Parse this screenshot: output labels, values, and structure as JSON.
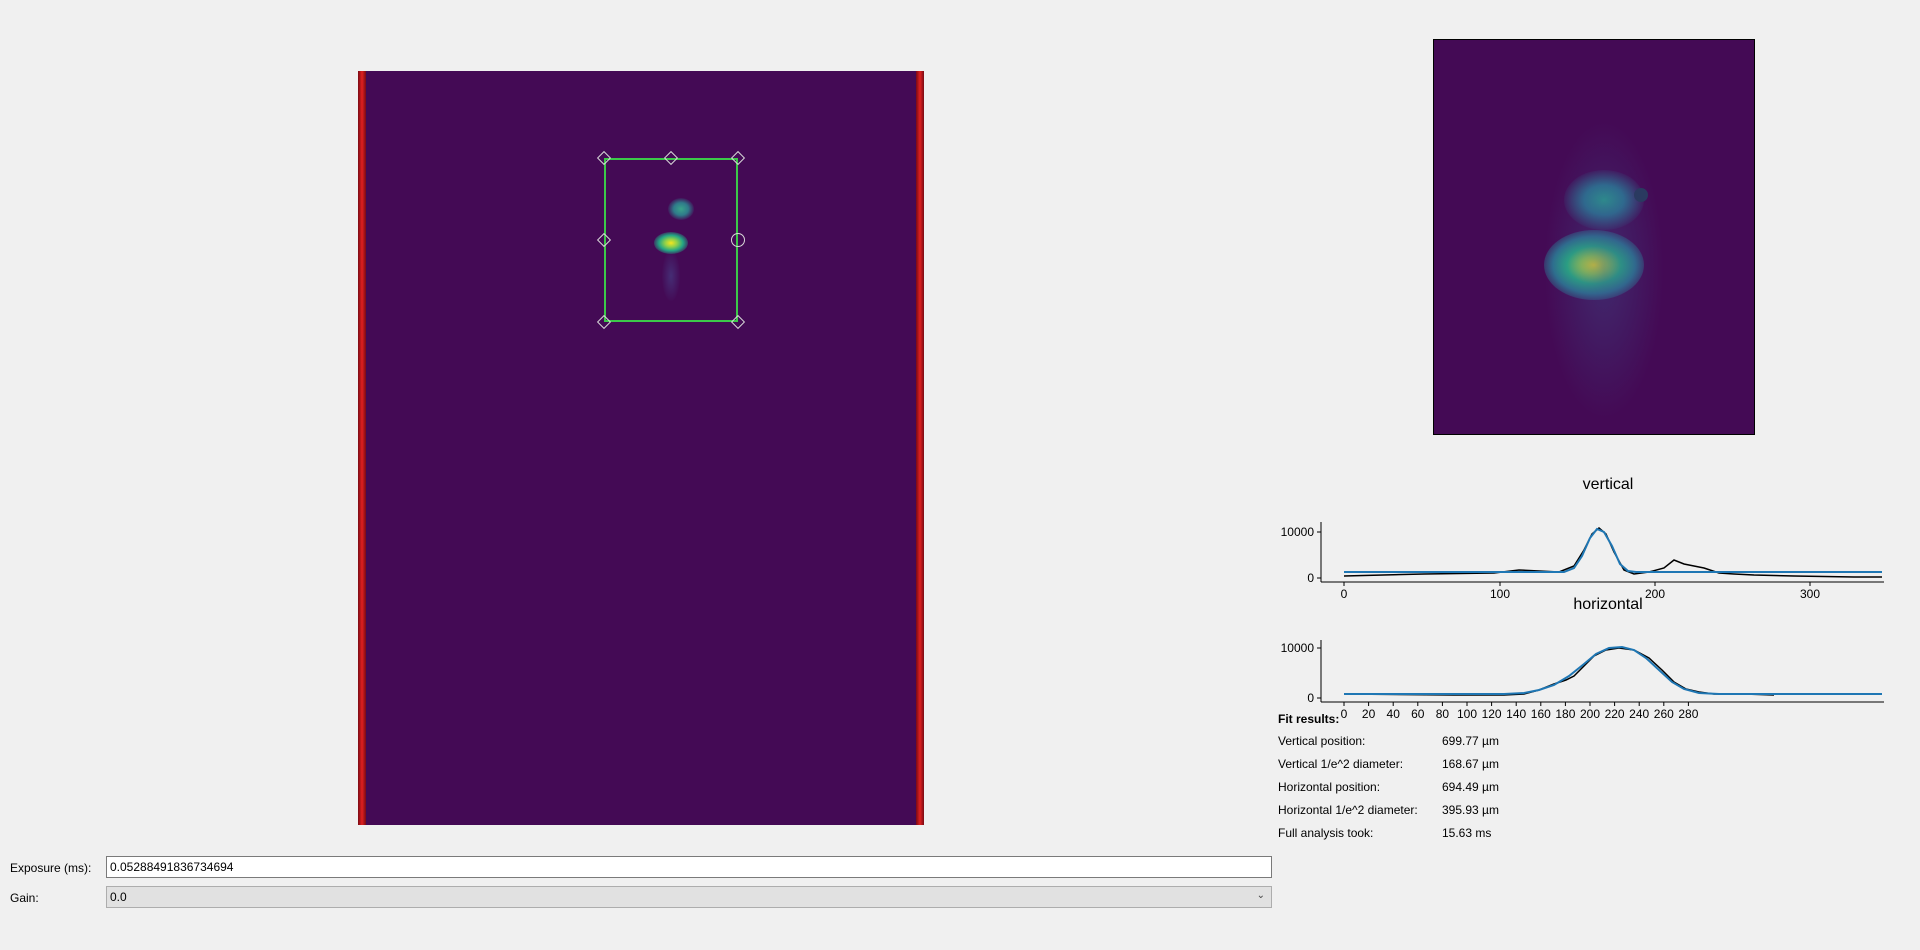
{
  "plots": {
    "vertical": {
      "title": "vertical",
      "y_ticks": [
        "10000",
        "0"
      ],
      "x_ticks": [
        "0",
        "100",
        "200",
        "300"
      ]
    },
    "horizontal": {
      "title": "horizontal",
      "y_ticks": [
        "10000",
        "0"
      ],
      "x_ticks": [
        "0",
        "20",
        "40",
        "60",
        "80",
        "100",
        "120",
        "140",
        "160",
        "180",
        "200",
        "220",
        "240",
        "260",
        "280"
      ]
    }
  },
  "fit": {
    "heading": "Fit results:",
    "rows": [
      {
        "label": "Vertical position:",
        "value": "699.77 µm"
      },
      {
        "label": "Vertical 1/e^2 diameter:",
        "value": "168.67 µm"
      },
      {
        "label": "Horizontal position:",
        "value": "694.49 µm"
      },
      {
        "label": "Horizontal 1/e^2 diameter:",
        "value": "395.93 µm"
      },
      {
        "label": "Full analysis took:",
        "value": "15.63 ms"
      }
    ]
  },
  "controls": {
    "exposure_label": "Exposure (ms):",
    "exposure_value": "0.05288491836734694",
    "gain_label": "Gain:",
    "gain_value": "0.0"
  },
  "colors": {
    "background": "#f0f0f0",
    "image_bg": "#440a55",
    "roi": "#3cc84a",
    "fit_curve": "#1f77b4",
    "data_curve": "#000000"
  }
}
